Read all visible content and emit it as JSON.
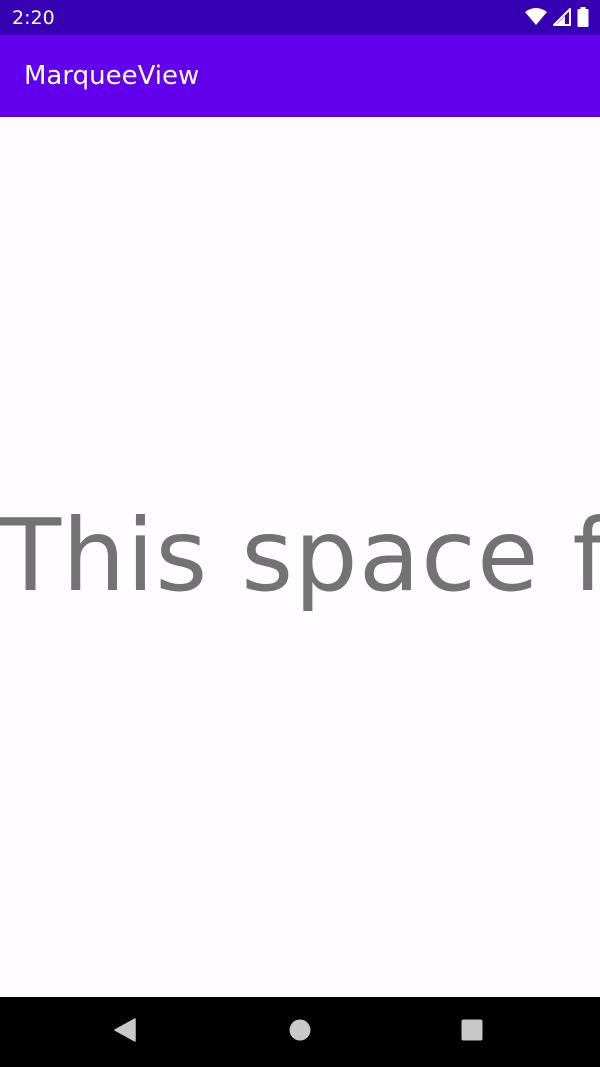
{
  "status_bar": {
    "time": "2:20",
    "icons": [
      "wifi-icon",
      "signal-icon",
      "battery-icon"
    ]
  },
  "app_bar": {
    "title": "MarqueeView",
    "color": "#6200ee"
  },
  "content": {
    "marquee_text": "This space fo"
  },
  "nav_bar": {
    "buttons": [
      "back-icon",
      "home-icon",
      "recents-icon"
    ]
  },
  "colors": {
    "status_bar": "#3700b3",
    "app_bar": "#6200ee",
    "background": "#fefcfe",
    "marquee_text": "#737373"
  }
}
